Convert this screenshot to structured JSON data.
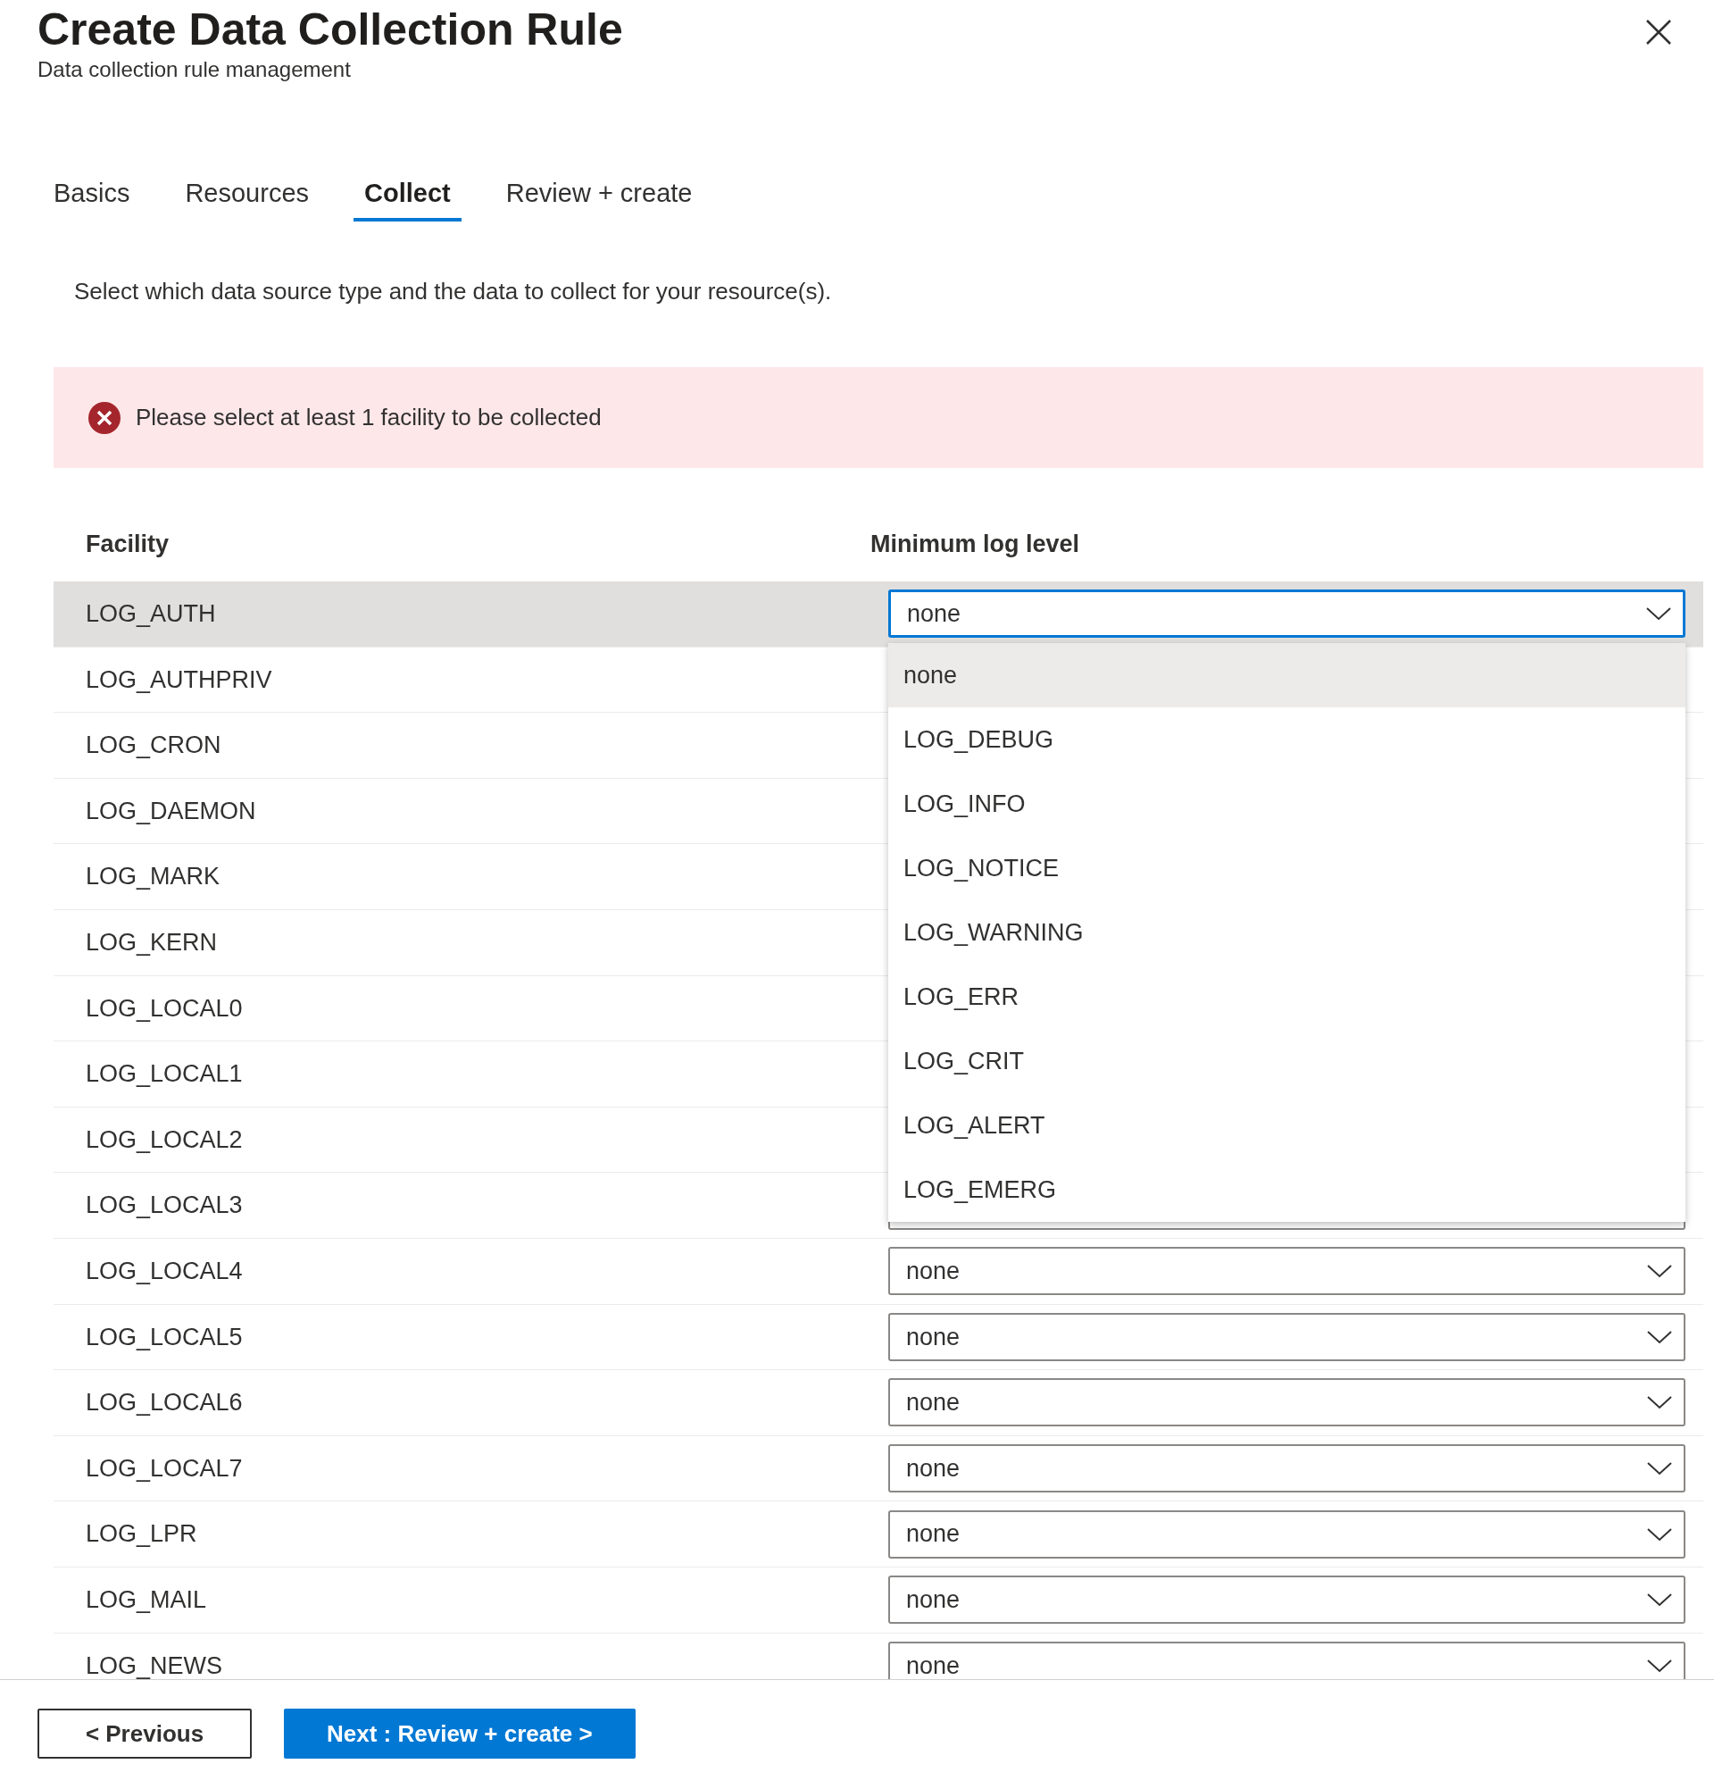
{
  "dialog": {
    "title": "Create Data Collection Rule",
    "subtitle": "Data collection rule management"
  },
  "tabs": [
    {
      "label": "Basics",
      "selected": false
    },
    {
      "label": "Resources",
      "selected": false
    },
    {
      "label": "Collect",
      "selected": true
    },
    {
      "label": "Review + create",
      "selected": false
    }
  ],
  "description": "Select which data source type and the data to collect for your resource(s).",
  "error": {
    "message": "Please select at least 1 facility to be collected"
  },
  "table": {
    "columns": [
      "Facility",
      "Minimum log level"
    ],
    "rows": [
      {
        "facility": "LOG_AUTH",
        "selected": true,
        "level": {
          "value": "none",
          "open": true
        }
      },
      {
        "facility": "LOG_AUTHPRIV",
        "selected": false
      },
      {
        "facility": "LOG_CRON",
        "selected": false
      },
      {
        "facility": "LOG_DAEMON",
        "selected": false
      },
      {
        "facility": "LOG_MARK",
        "selected": false
      },
      {
        "facility": "LOG_KERN",
        "selected": false
      },
      {
        "facility": "LOG_LOCAL0",
        "selected": false
      },
      {
        "facility": "LOG_LOCAL1",
        "selected": false
      },
      {
        "facility": "LOG_LOCAL2",
        "selected": false
      },
      {
        "facility": "LOG_LOCAL3",
        "selected": false
      },
      {
        "facility": "LOG_LOCAL4",
        "selected": false,
        "level": {
          "value": "none",
          "open": false
        }
      },
      {
        "facility": "LOG_LOCAL5",
        "selected": false,
        "level": {
          "value": "none",
          "open": false
        }
      },
      {
        "facility": "LOG_LOCAL6",
        "selected": false,
        "level": {
          "value": "none",
          "open": false
        }
      },
      {
        "facility": "LOG_LOCAL7",
        "selected": false,
        "level": {
          "value": "none",
          "open": false
        }
      },
      {
        "facility": "LOG_LPR",
        "selected": false,
        "level": {
          "value": "none",
          "open": false
        }
      },
      {
        "facility": "LOG_MAIL",
        "selected": false,
        "level": {
          "value": "none",
          "open": false
        }
      },
      {
        "facility": "LOG_NEWS",
        "selected": false,
        "level": {
          "value": "none",
          "open": false
        }
      }
    ]
  },
  "dropdown": {
    "options": [
      {
        "label": "none",
        "selected": true
      },
      {
        "label": "LOG_DEBUG",
        "selected": false
      },
      {
        "label": "LOG_INFO",
        "selected": false
      },
      {
        "label": "LOG_NOTICE",
        "selected": false
      },
      {
        "label": "LOG_WARNING",
        "selected": false
      },
      {
        "label": "LOG_ERR",
        "selected": false
      },
      {
        "label": "LOG_CRIT",
        "selected": false
      },
      {
        "label": "LOG_ALERT",
        "selected": false
      },
      {
        "label": "LOG_EMERG",
        "selected": false
      }
    ]
  },
  "buttons": [
    {
      "label": "< Previous",
      "kind": "secondary"
    },
    {
      "label": "Next : Review + create >",
      "kind": "primary"
    }
  ]
}
